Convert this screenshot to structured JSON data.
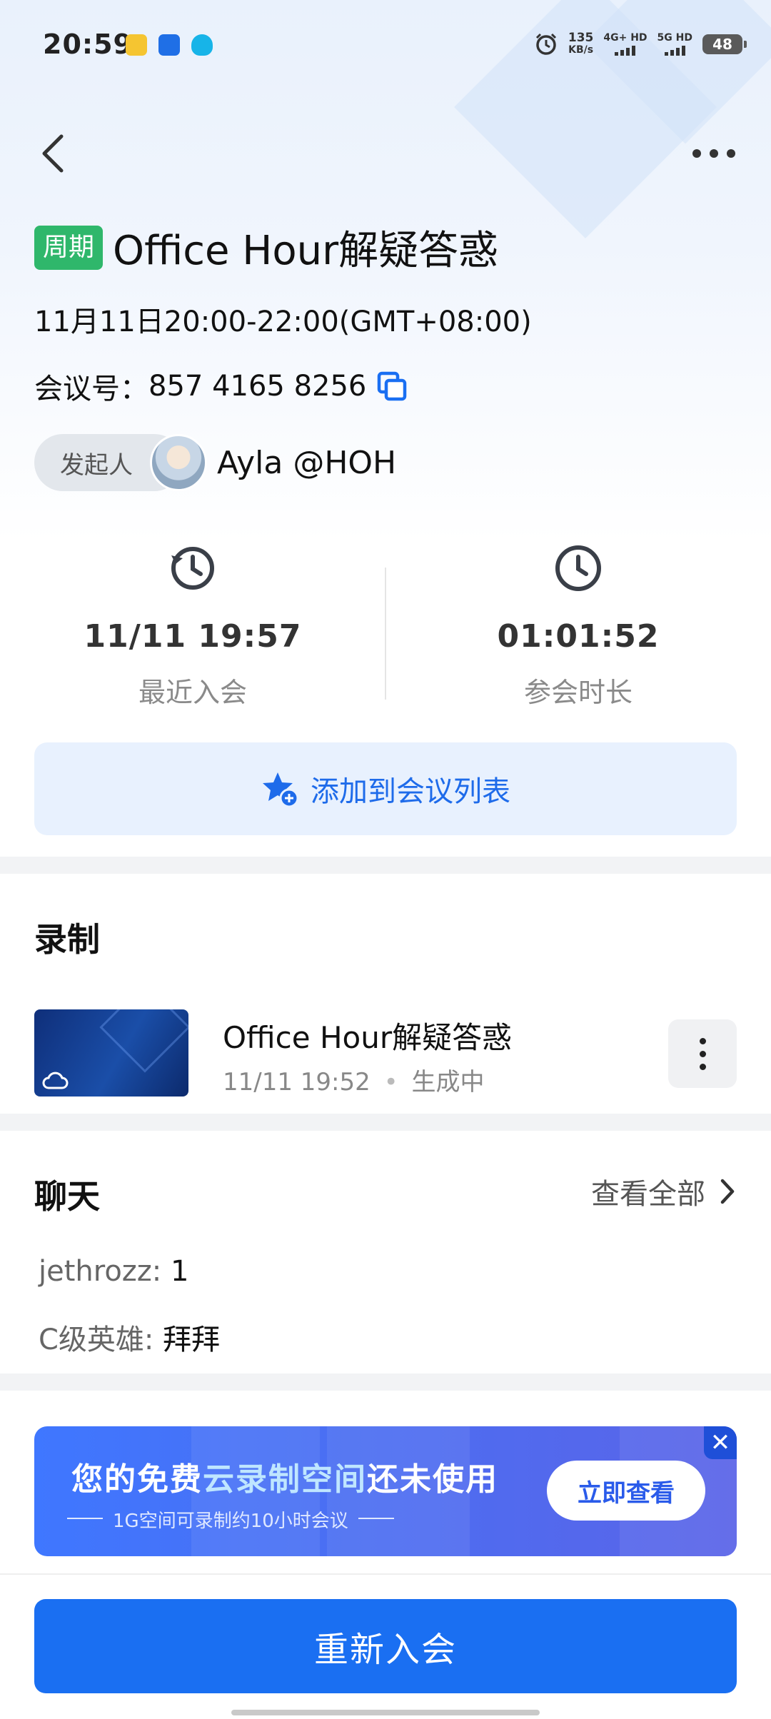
{
  "status_bar": {
    "time": "20:59",
    "net_speed_value": "135",
    "net_speed_unit": "KB/s",
    "sim1_label": "4G+ HD",
    "sim2_label": "5G HD",
    "battery": "48"
  },
  "meeting": {
    "tag": "周期",
    "title": "Office Hour解疑答惑",
    "datetime": "11月11日20:00-22:00(GMT+08:00)",
    "meeting_id_label": "会议号：",
    "meeting_id": "857 4165 8256",
    "host_label": "发起人",
    "host_name": "Ayla @HOH"
  },
  "stats": {
    "last_join_value": "11/11 19:57",
    "last_join_label": "最近入会",
    "duration_value": "01:01:52",
    "duration_label": "参会时长"
  },
  "add_to_list_label": "添加到会议列表",
  "recording": {
    "section_title": "录制",
    "item_title": "Office Hour解疑答惑",
    "item_time": "11/11 19:52",
    "item_status": "生成中"
  },
  "chat": {
    "section_title": "聊天",
    "view_all": "查看全部",
    "messages": [
      {
        "sender": "jethrozz:",
        "text": "1"
      },
      {
        "sender": "C级英雄:",
        "text": "拜拜"
      }
    ]
  },
  "banner": {
    "title_part1": "您的免费",
    "title_highlight": "云录制空间",
    "title_part2": "还未使用",
    "subtitle": "1G空间可录制约10小时会议",
    "button": "立即查看",
    "close": "✕"
  },
  "rejoin_button": "重新入会",
  "colors": {
    "accent": "#1a6ff2",
    "tag_green": "#2fb76b",
    "banner_blue": "#4b6ef2"
  }
}
